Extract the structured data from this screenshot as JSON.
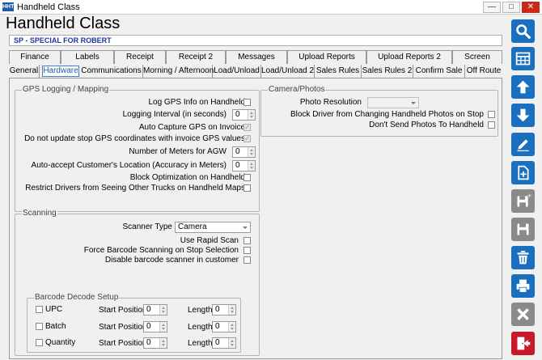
{
  "window": {
    "title": "Handheld Class",
    "icon_text": "HHT"
  },
  "header": {
    "title": "Handheld Class",
    "subtitle": "SP - SPECIAL FOR  ROBERT"
  },
  "tabs_row1": [
    "Finance",
    "Labels",
    "Receipt",
    "Receipt 2",
    "Messages",
    "Upload Reports",
    "Upload Reports 2",
    "Screen"
  ],
  "tabs_row2": [
    "General",
    "Hardware",
    "Communications",
    "Morning / Afternoon",
    "Load/Unload",
    "Load/Unload 2",
    "Sales Rules",
    "Sales Rules 2",
    "Confirm Sale",
    "Off Route"
  ],
  "active_tab": "Hardware",
  "gps": {
    "title": "GPS Logging / Mapping",
    "log_info": {
      "label": "Log GPS Info on Handheld",
      "checked": false
    },
    "logging_interval": {
      "label": "Logging Interval (in seconds)",
      "value": "0"
    },
    "auto_capture": {
      "label": "Auto Capture GPS on Invoice",
      "checked": true
    },
    "no_update": {
      "label": "Do not update stop GPS coordinates with invoice GPS values",
      "checked": true
    },
    "meters_agw": {
      "label": "Number of Meters for AGW",
      "value": "0"
    },
    "auto_accept": {
      "label": "Auto-accept Customer's Location (Accuracy in Meters)",
      "value": "0"
    },
    "block_opt": {
      "label": "Block Optimization on Handheld",
      "checked": false
    },
    "restrict": {
      "label": "Restrict Drivers from Seeing Other Trucks on Handheld Maps",
      "checked": false
    }
  },
  "camera": {
    "title": "Camera/Photos",
    "resolution_label": "Photo Resolution",
    "resolution_value": "",
    "block_driver": {
      "label": "Block Driver from Changing Handheld Photos on Stop",
      "checked": false
    },
    "dont_send": {
      "label": "Don't Send Photos To Handheld",
      "checked": false
    }
  },
  "scanning": {
    "title": "Scanning",
    "scanner_type_label": "Scanner Type",
    "scanner_type_value": "Camera",
    "rapid": {
      "label": "Use Rapid Scan",
      "checked": false
    },
    "force": {
      "label": "Force Barcode Scanning on Stop Selection",
      "checked": false
    },
    "disable": {
      "label": "Disable barcode scanner in customer",
      "checked": false
    }
  },
  "barcode": {
    "title": "Barcode Decode Setup",
    "start_label": "Start Position",
    "length_label": "Length",
    "rows": [
      {
        "label": "UPC",
        "checked": false,
        "start": "0",
        "length": "0"
      },
      {
        "label": "Batch",
        "checked": false,
        "start": "0",
        "length": "0"
      },
      {
        "label": "Quantity",
        "checked": false,
        "start": "0",
        "length": "0"
      }
    ]
  },
  "sidebar_icons": [
    "search-icon",
    "grid-icon",
    "arrow-up-icon",
    "arrow-down-icon",
    "edit-icon",
    "new-document-icon",
    "save-new-icon",
    "save-icon",
    "delete-icon",
    "print-icon",
    "cancel-icon",
    "exit-icon"
  ],
  "colors": {
    "accent": "#1b6fbf",
    "disabled": "#8a8a8a",
    "exit": "#c8192a",
    "subtitle_text": "#1a36a0"
  }
}
